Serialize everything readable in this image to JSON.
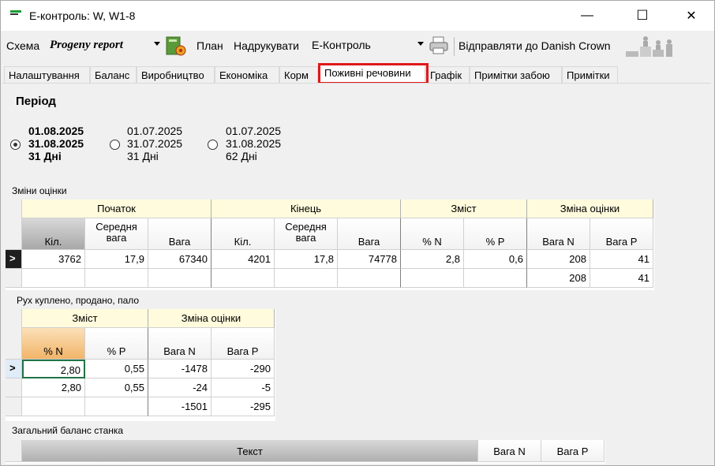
{
  "window": {
    "title": "E-контроль: W, W1-8",
    "min": "—",
    "max": "☐",
    "close": "✕"
  },
  "toolbar": {
    "schema_label": "Схема",
    "schema_value": "Progeny report",
    "plan_label": "План",
    "print_label": "Надрукувати",
    "print_value": "E-Контроль",
    "send_label": "Відправляти до Danish Crown"
  },
  "tabs": [
    "Налаштування",
    "Баланс",
    "Виробництво",
    "Економіка",
    "Корм",
    "Поживні речовини",
    "Графік",
    "Примітки забою",
    "Примітки"
  ],
  "period": {
    "title": "Період",
    "options": [
      {
        "l1": "01.08.2025",
        "l2": "31.08.2025",
        "l3": "31 Дні",
        "selected": true
      },
      {
        "l1": "01.07.2025",
        "l2": "31.07.2025",
        "l3": "31 Дні",
        "selected": false
      },
      {
        "l1": "01.07.2025",
        "l2": "31.08.2025",
        "l3": "62 Дні",
        "selected": false
      }
    ]
  },
  "grid1": {
    "caption": "Зміни оцінки",
    "groups": [
      "Початок",
      "Кінець",
      "Зміст",
      "Зміна оцінки"
    ],
    "cols": [
      "Кіл.",
      "Середня вага",
      "Вага",
      "Кіл.",
      "Середня вага",
      "Вага",
      "% N",
      "% P",
      "Вага N",
      "Вага P"
    ],
    "rows": [
      [
        "3762",
        "17,9",
        "67340",
        "4201",
        "17,8",
        "74778",
        "2,8",
        "0,6",
        "208",
        "41"
      ],
      [
        "",
        "",
        "",
        "",
        "",
        "",
        "",
        "",
        "208",
        "41"
      ]
    ]
  },
  "grid2": {
    "caption": "Рух куплено, продано, пало",
    "groups": [
      "Зміст",
      "Зміна оцінки"
    ],
    "cols": [
      "% N",
      "% P",
      "Вага N",
      "Вага P"
    ],
    "rows": [
      [
        "2,80",
        "0,55",
        "-1478",
        "-290"
      ],
      [
        "2,80",
        "0,55",
        "-24",
        "-5"
      ],
      [
        "",
        "",
        "-1501",
        "-295"
      ]
    ]
  },
  "grid3": {
    "caption": "Загальний баланс станка",
    "cols": [
      "Текст",
      "Вага N",
      "Вага P"
    ]
  },
  "row_marker": ">"
}
